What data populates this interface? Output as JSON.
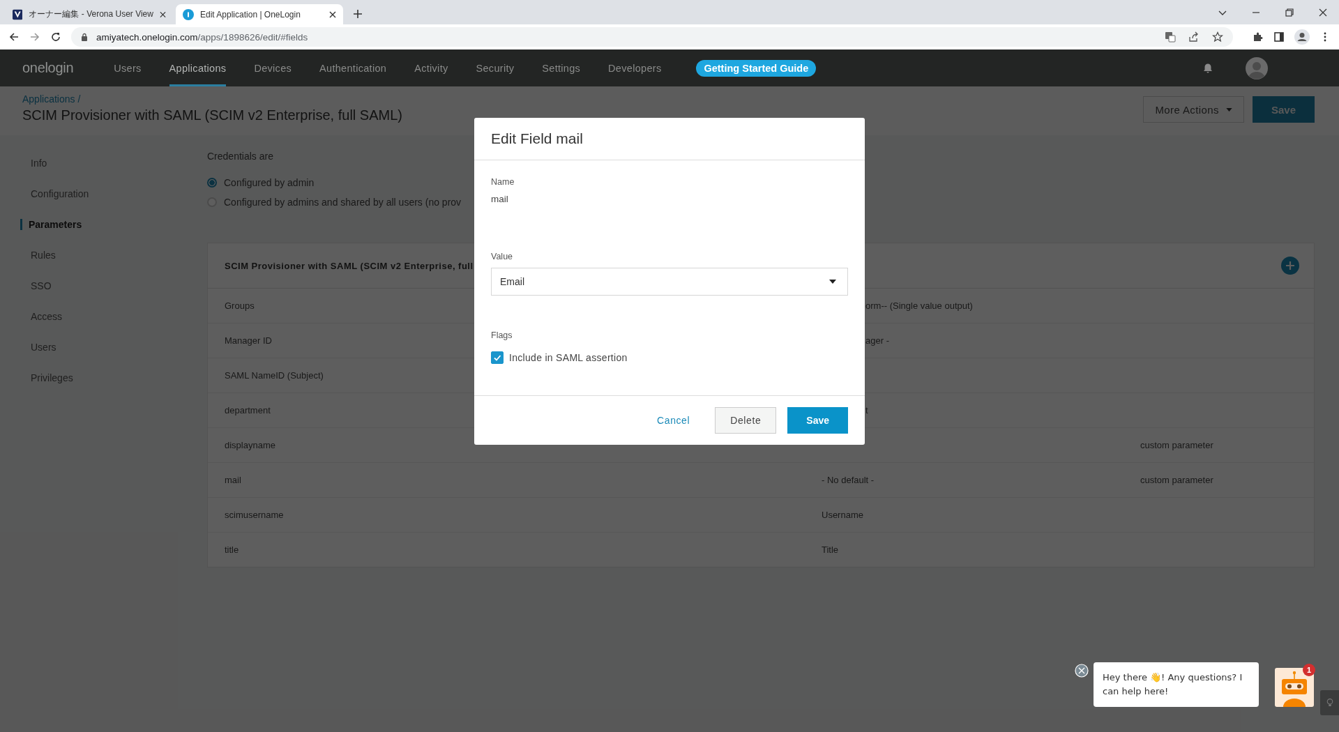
{
  "browser": {
    "tabs": [
      {
        "title": "オーナー編集 - Verona User View",
        "selected": false,
        "kind": "verona"
      },
      {
        "title": "Edit Application | OneLogin",
        "selected": true,
        "kind": "onelogin"
      }
    ],
    "url": {
      "host": "amiyatech.onelogin.com",
      "path": "/apps/1898626/edit/#fields"
    }
  },
  "nav": {
    "logo": "onelogin",
    "items": [
      {
        "label": "Users",
        "selected": false
      },
      {
        "label": "Applications",
        "selected": true
      },
      {
        "label": "Devices",
        "selected": false
      },
      {
        "label": "Authentication",
        "selected": false
      },
      {
        "label": "Activity",
        "selected": false
      },
      {
        "label": "Security",
        "selected": false
      },
      {
        "label": "Settings",
        "selected": false
      },
      {
        "label": "Developers",
        "selected": false
      }
    ],
    "guide_button": "Getting Started Guide"
  },
  "page": {
    "breadcrumb": "Applications /",
    "title": "SCIM Provisioner with SAML (SCIM v2 Enterprise, full SAML)",
    "more_actions": "More Actions",
    "save": "Save"
  },
  "sidebar": [
    {
      "label": "Info",
      "selected": false
    },
    {
      "label": "Configuration",
      "selected": false
    },
    {
      "label": "Parameters",
      "selected": true
    },
    {
      "label": "Rules",
      "selected": false
    },
    {
      "label": "SSO",
      "selected": false
    },
    {
      "label": "Access",
      "selected": false
    },
    {
      "label": "Users",
      "selected": false
    },
    {
      "label": "Privileges",
      "selected": false
    }
  ],
  "credentials": {
    "label": "Credentials are",
    "options": [
      {
        "label": "Configured by admin",
        "selected": true
      },
      {
        "label": "Configured by admins and shared by all users (no prov",
        "selected": false
      }
    ]
  },
  "table": {
    "title": "SCIM Provisioner with SAML (SCIM v2 Enterprise, full",
    "rows": [
      {
        "name": "Groups",
        "value_tail": "orm-- (Single value output)"
      },
      {
        "name": "Manager ID",
        "value_tail": "ager -"
      },
      {
        "name": "SAML NameID (Subject)"
      },
      {
        "name": "department",
        "value_tail": "t"
      },
      {
        "name": "displayname",
        "type": "custom parameter"
      },
      {
        "name": "mail",
        "value": "- No default -",
        "type": "custom parameter"
      },
      {
        "name": "scimusername",
        "value": "Username"
      },
      {
        "name": "title",
        "value": "Title"
      }
    ]
  },
  "modal": {
    "title": "Edit Field mail",
    "name_label": "Name",
    "name_value": "mail",
    "value_label": "Value",
    "value_select": "Email",
    "flags_label": "Flags",
    "flags": [
      {
        "label": "Include in SAML assertion",
        "checked": true
      }
    ],
    "cancel": "Cancel",
    "delete": "Delete",
    "save": "Save"
  },
  "chat": {
    "message": "Hey there 👋! Any questions? I can help here!",
    "badge": "1"
  }
}
